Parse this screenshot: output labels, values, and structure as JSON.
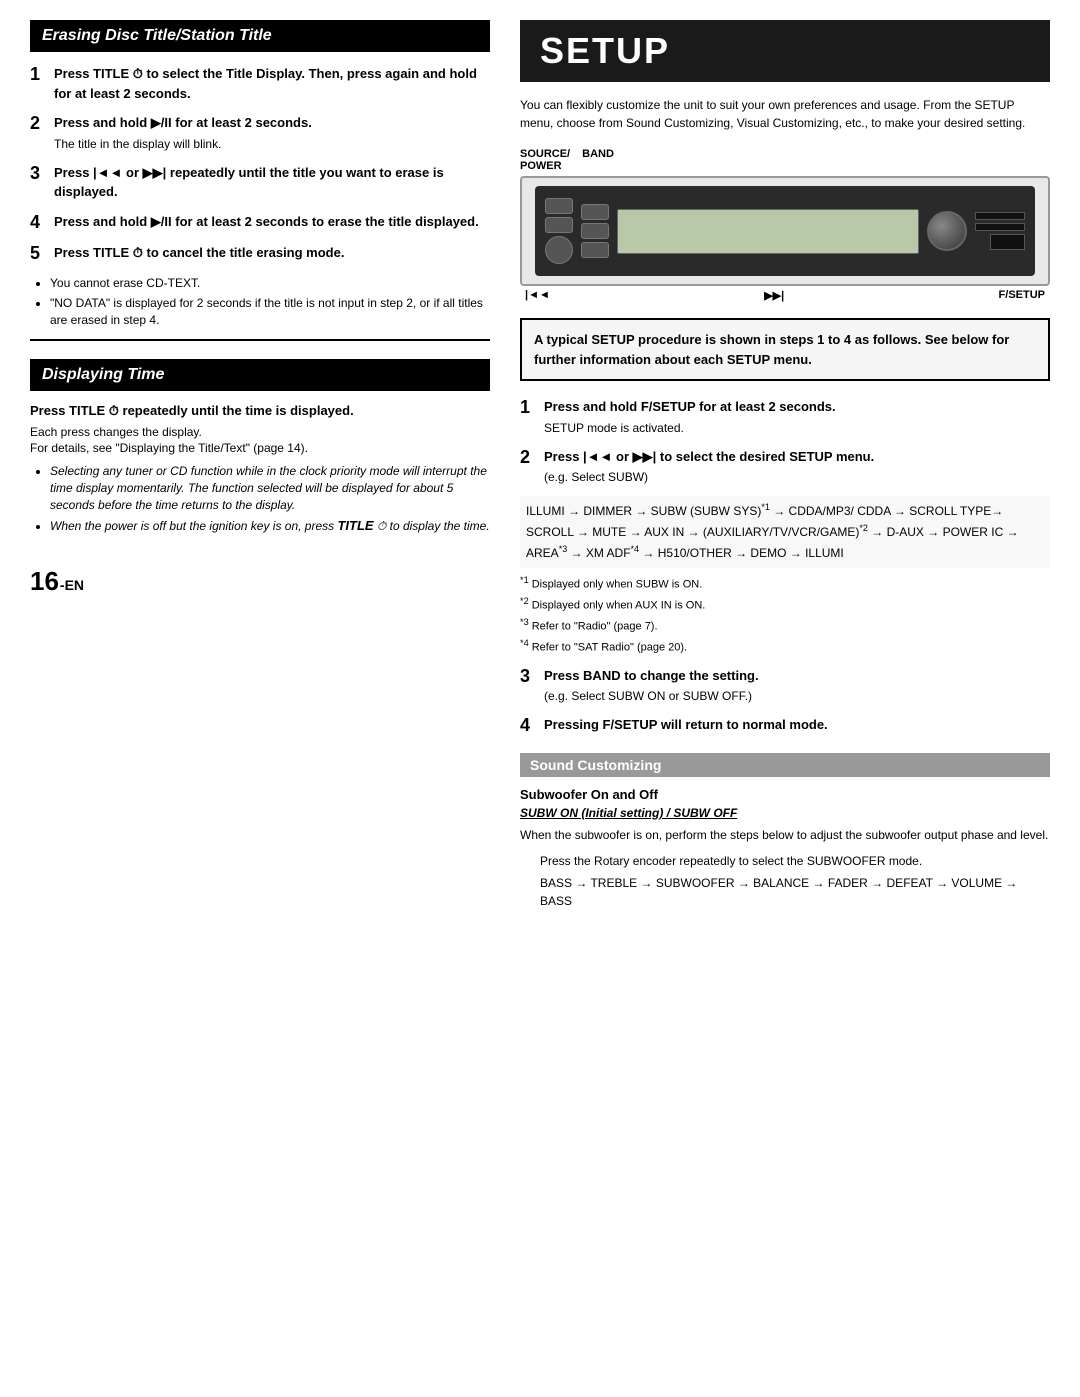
{
  "left": {
    "erasing_title": "Erasing Disc Title/Station Title",
    "steps": [
      {
        "number": "1",
        "text": "Press TITLE ⏱ to select the Title Display. Then, press again and hold for at least 2 seconds."
      },
      {
        "number": "2",
        "text": "Press and hold ▶/II for at least 2 seconds.",
        "sub": "The title in the display will blink."
      },
      {
        "number": "3",
        "text": "Press |◄◄ or ▶▶| repeatedly until the title you want to erase is displayed."
      },
      {
        "number": "4",
        "text": "Press and hold ▶/II for at least 2 seconds to erase the title displayed."
      },
      {
        "number": "5",
        "text": "Press TITLE ⏱ to cancel the title erasing mode."
      }
    ],
    "bullets": [
      "You cannot erase CD-TEXT.",
      "\"NO DATA\" is displayed for 2 seconds if the title is not input in step 2, or if all titles are erased in step 4."
    ],
    "displaying_title": "Displaying Time",
    "press_title_line": "Press TITLE ⏱ repeatedly until the time is displayed.",
    "each_press": "Each press changes the display.",
    "for_details": "For details, see \"Displaying the Title/Text\" (page 14).",
    "bullets2": [
      "Selecting any tuner or CD function while in the clock priority mode will interrupt the time display momentarily. The function selected will be displayed for about 5 seconds before the time returns to the display.",
      "When the power is off but the ignition key is on, press TITLE ⏱ to display the time."
    ]
  },
  "right": {
    "setup_title": "SETUP",
    "intro": "You can flexibly customize the unit to suit your own preferences and usage. From the SETUP menu, choose from Sound Customizing, Visual Customizing, etc., to make your desired setting.",
    "device_labels": {
      "source_power": "SOURCE/ POWER",
      "band": "BAND"
    },
    "device_bottom": {
      "left": "|◄◄",
      "middle": "▶▶|",
      "right": "F/SETUP"
    },
    "info_box": "A typical SETUP procedure is shown in steps 1 to 4 as follows. See below for further information about each SETUP menu.",
    "setup_steps": [
      {
        "number": "1",
        "text": "Press and hold F/SETUP for at least 2 seconds.",
        "sub": "SETUP mode is activated."
      },
      {
        "number": "2",
        "text": "Press |◄◄ or ▶▶| to select the desired SETUP menu.",
        "sub": "(e.g. Select SUBW)"
      },
      {
        "number": "3",
        "text": "Press BAND to change the setting.",
        "sub": "(e.g. Select SUBW ON or SUBW OFF.)"
      },
      {
        "number": "4",
        "text": "Pressing F/SETUP will return to normal mode."
      }
    ],
    "flow_text": "ILLUMI → DIMMER → SUBW (SUBW SYS)*¹ → CDDA/MP3/ CDDA → SCROLL TYPE→ SCROLL → MUTE → AUX IN → (AUXILIARY/TV/VCR/GAME)*² → D-AUX → POWER IC → AREA*³ → XM ADF*⁴ → H510/OTHER → DEMO → ILLUMI",
    "footnotes": [
      "*¹ Displayed only when SUBW is ON.",
      "*² Displayed only when AUX IN is ON.",
      "*³ Refer to \"Radio\" (page 7).",
      "*⁴ Refer to \"SAT Radio\" (page 20)."
    ],
    "sound_customizing": {
      "header": "Sound Customizing",
      "subwoofer_title": "Subwoofer On and Off",
      "subwoofer_subtitle": "SUBW ON (Initial setting) / SUBW OFF",
      "desc": "When the subwoofer is on, perform the steps below to adjust the subwoofer output phase and level.",
      "indented1": "Press the Rotary encoder repeatedly to select the SUBWOOFER mode.",
      "flow2": "BASS → TREBLE → SUBWOOFER → BALANCE → FADER → DEFEAT → VOLUME → BASS"
    }
  },
  "page_number": "16",
  "page_suffix": "-EN"
}
